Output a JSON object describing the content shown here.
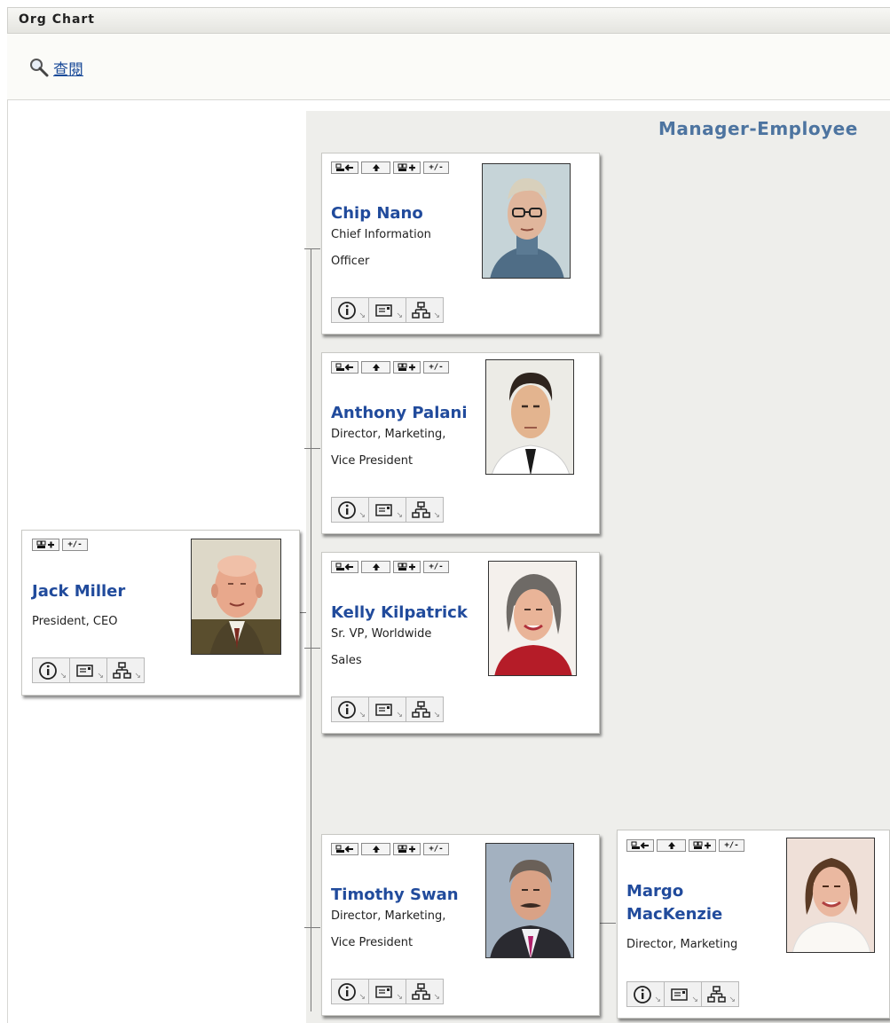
{
  "app_title": "Org Chart",
  "toolbar": {
    "lookup_label": "查閱"
  },
  "view_title": "Manager-Employee",
  "icons": {
    "lookup": "magnifier-icon",
    "show_manager": "show-manager-icon",
    "up_level": "up-arrow-icon",
    "show_reports": "show-reports-icon",
    "expand_collapse": "+/-",
    "info": "info-icon",
    "email": "email-icon",
    "org": "org-chart-icon"
  },
  "colors": {
    "name_link": "#214b9c",
    "view_title": "#4d74a0",
    "panel": "#eeeeeb"
  },
  "root": {
    "name": "Jack Miller",
    "title_lines": [
      "President, CEO",
      ""
    ]
  },
  "reports": [
    {
      "name": "Chip Nano",
      "title_lines": [
        "Chief Information",
        "Officer"
      ]
    },
    {
      "name": "Anthony Palani",
      "title_lines": [
        "Director, Marketing,",
        "Vice President"
      ]
    },
    {
      "name": "Kelly Kilpatrick",
      "title_lines": [
        "Sr. VP, Worldwide",
        "Sales"
      ]
    },
    {
      "name": "Timothy Swan",
      "title_lines": [
        "Director, Marketing,",
        "Vice President"
      ]
    }
  ],
  "sub_report": {
    "name_lines": [
      "Margo",
      "MacKenzie"
    ],
    "title_lines": [
      "Director, Marketing"
    ]
  }
}
